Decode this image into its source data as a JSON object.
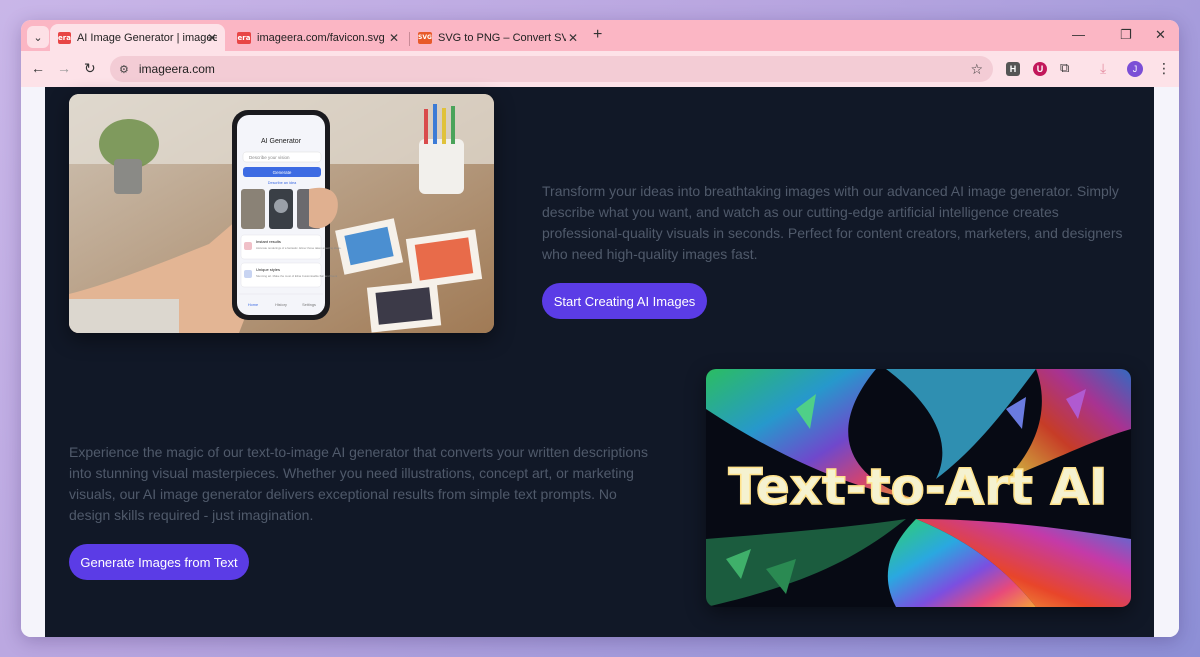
{
  "browser": {
    "tabs": [
      {
        "title": "AI Image Generator | imageera",
        "favicon_text": "era",
        "active": true
      },
      {
        "title": "imageera.com/favicon.svg",
        "favicon_text": "era",
        "active": false
      },
      {
        "title": "SVG to PNG – Convert SVG files",
        "favicon_text": "SVG",
        "active": false
      }
    ],
    "url": "imageera.com",
    "profile_initial": "J",
    "extensions": [
      "H",
      "U"
    ]
  },
  "section1": {
    "description": "Transform your ideas into breathtaking images with our advanced AI image generator. Simply describe what you want, and watch as our cutting-edge artificial intelligence creates professional-quality visuals in seconds. Perfect for content creators, marketers, and designers who need high-quality images fast.",
    "button_label": "Start Creating AI Images",
    "phone": {
      "app_title": "AI Generator",
      "input_placeholder": "Describe your vision",
      "generate_label": "Generate",
      "link_label": "Describe an idea",
      "list_items": [
        {
          "title": "Instant results",
          "subtitle": "Accurate renderings of a fantastic. Elmer those taken amazing ideas."
        },
        {
          "title": "Unique styles",
          "subtitle": "Stunning art. Make the most of Elina Customisable flair and fluent"
        }
      ],
      "nav": [
        "Home",
        "History",
        "Settings"
      ]
    }
  },
  "section2": {
    "description": "Experience the magic of our text-to-image AI generator that converts your written descriptions into stunning visual masterpieces. Whether you need illustrations, concept art, or marketing visuals, our AI image generator delivers exceptional results from simple text prompts. No design skills required - just imagination.",
    "button_label": "Generate Images from Text",
    "art_text": "Text-to-Art AI"
  }
}
